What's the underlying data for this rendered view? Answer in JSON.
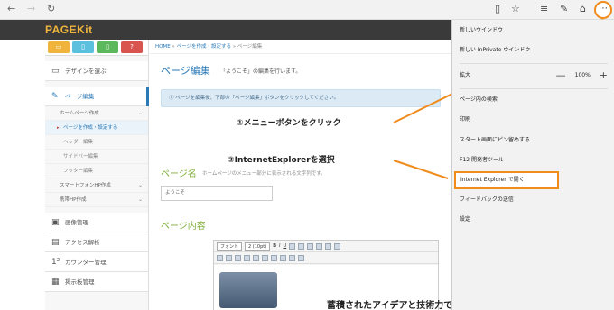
{
  "browser": {
    "back_icon": "arrow-left",
    "forward_icon": "arrow-right",
    "refresh_icon": "refresh",
    "more_label": "⋯"
  },
  "app": {
    "logo": "PAGEKit",
    "color_buttons": [
      {
        "icon": "monitor",
        "color": "#f0b43c",
        "glyph": "▭"
      },
      {
        "icon": "tablet",
        "color": "#5bc0de",
        "glyph": "▯"
      },
      {
        "icon": "phone",
        "color": "#5cb85c",
        "glyph": "▯"
      },
      {
        "icon": "help",
        "color": "#d9534f",
        "glyph": "?"
      }
    ]
  },
  "sidebar": {
    "design": "デザインを選ぶ",
    "page_edit": "ページ編集",
    "home_page_create": "ホームページ作成",
    "page_create_setting": "ページを作成・設定する",
    "header_edit": "ヘッダー編集",
    "sidebar_edit": "サイドバー編集",
    "footer_edit": "フッター編集",
    "smartphone_create": "スマートフォンHP作成",
    "mobile_create": "携帯HP作成",
    "image_manage": "画像管理",
    "access_analysis": "アクセス解析",
    "counter_manage": "カウンター管理",
    "board_manage": "掲示板管理"
  },
  "main": {
    "breadcrumb_home": "HOME",
    "breadcrumb_mid": "ページを作成・設定する",
    "breadcrumb_current": "ページ編集",
    "title": "ページ編集",
    "subtitle": "「ようこそ」の編集を行います。",
    "info": "ページを編集後、下部の「ページ編集」ボタンをクリックしてください。",
    "name_section": "ページ名",
    "name_hint": "ホームページのメニュー部分に表示される文字列です。",
    "name_value": "ようこそ",
    "content_section": "ページ内容",
    "font_select": "フォント",
    "size_select": "2 (10pt)",
    "editor_text": "蓄積されたアイデアと技術力で"
  },
  "annotations": {
    "step1": "①メニューボタンをクリック",
    "step2": "②InternetExplorerを選択",
    "color": "#f08c1e"
  },
  "menu": {
    "new_window": "新しいウインドウ",
    "inprivate": "新しい InPrivate ウインドウ",
    "zoom_label": "拡大",
    "zoom_minus": "—",
    "zoom_value": "100%",
    "zoom_plus": "+",
    "find": "ページ内の検索",
    "print": "印刷",
    "pin": "スタート画面にピン留めする",
    "devtools": "F12 開発者ツール",
    "open_ie": "Internet Explorer で開く",
    "feedback": "フィードバックの送信",
    "settings": "設定"
  }
}
